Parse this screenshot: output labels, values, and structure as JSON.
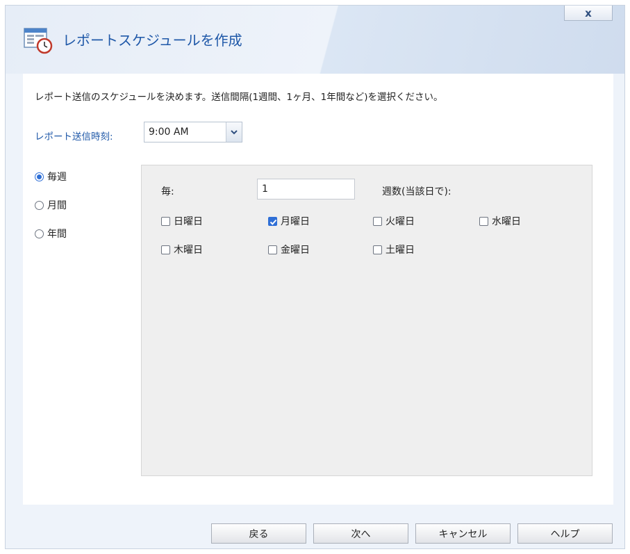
{
  "window": {
    "title": "レポートスケジュールを作成",
    "close_label": "x"
  },
  "description": "レポート送信のスケジュールを決めます。送信間隔(1週間、1ヶ月、1年間など)を選択ください。",
  "send_time": {
    "label": "レポート送信時刻:",
    "value": "9:00 AM"
  },
  "frequency": [
    {
      "label": "毎週",
      "selected": true
    },
    {
      "label": "月間",
      "selected": false
    },
    {
      "label": "年間",
      "selected": false
    }
  ],
  "weekly": {
    "every_label": "毎:",
    "every_value": "1",
    "weeks_label": "週数(当該日で):",
    "days": [
      {
        "label": "日曜日",
        "checked": false
      },
      {
        "label": "月曜日",
        "checked": true
      },
      {
        "label": "火曜日",
        "checked": false
      },
      {
        "label": "水曜日",
        "checked": false
      },
      {
        "label": "木曜日",
        "checked": false
      },
      {
        "label": "金曜日",
        "checked": false
      },
      {
        "label": "土曜日",
        "checked": false
      }
    ]
  },
  "buttons": {
    "back": "戻る",
    "next": "次へ",
    "cancel": "キャンセル",
    "help": "ヘルプ"
  },
  "colors": {
    "accent": "#1f58a8",
    "check": "#2f6fd6",
    "panel": "#efefef",
    "frame": "#eef3fa"
  }
}
